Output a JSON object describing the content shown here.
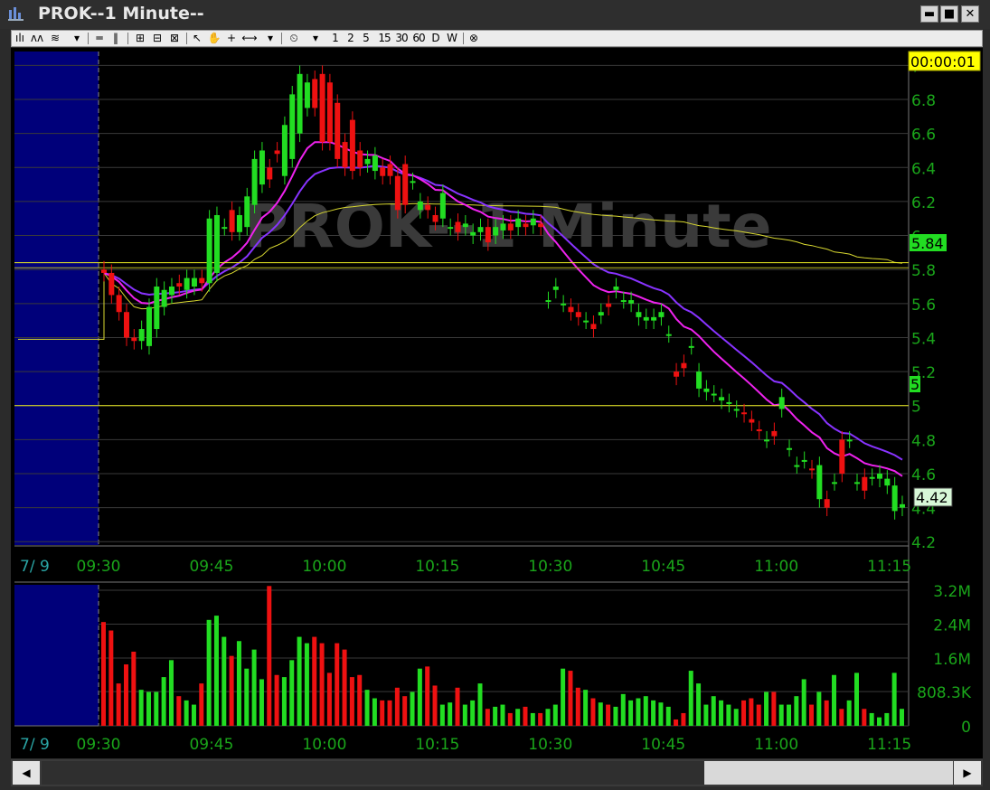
{
  "window": {
    "title": "PROK--1 Minute--",
    "minimize": "▬",
    "maximize": "■",
    "close": "✕"
  },
  "toolbar": {
    "intervals": [
      "1",
      "2",
      "5",
      "15",
      "30",
      "60",
      "D",
      "W"
    ]
  },
  "clock": "00:00:01",
  "watermark": "PROK--1 Minute",
  "colors": {
    "up": "#22dd22",
    "down": "#ee1111",
    "ema_fast": "#ee22ee",
    "ema_slow": "#8833ff",
    "vwap": "#d8d830",
    "level": "#eeee22",
    "premarket": "#00007a",
    "grid": "#3a3a3a",
    "axis_text": "#1aa51a"
  },
  "price_labels": {
    "level_high": "5.84",
    "level_line": "5",
    "last": "4.42"
  },
  "x_axis": {
    "date": "7/ 9",
    "ticks": [
      "09:30",
      "09:45",
      "10:00",
      "10:15",
      "10:30",
      "10:45",
      "11:00",
      "11:15"
    ]
  },
  "chart_data": [
    {
      "type": "candlestick",
      "title": "PROK--1 Minute",
      "y_ticks": [
        "4.2",
        "4.4",
        "4.6",
        "4.8",
        "5",
        "5.2",
        "5.4",
        "5.6",
        "5.8",
        "6",
        "6.2",
        "6.4",
        "6.6",
        "6.8",
        "7"
      ],
      "ylim": [
        4.18,
        7.05
      ],
      "x": [
        "09:30",
        "09:31",
        "09:32",
        "09:33",
        "09:34",
        "09:35",
        "09:36",
        "09:37",
        "09:38",
        "09:39",
        "09:40",
        "09:41",
        "09:42",
        "09:43",
        "09:44",
        "09:45",
        "09:46",
        "09:47",
        "09:48",
        "09:49",
        "09:50",
        "09:51",
        "09:52",
        "09:53",
        "09:54",
        "09:55",
        "09:56",
        "09:57",
        "09:58",
        "09:59",
        "10:00",
        "10:01",
        "10:02",
        "10:03",
        "10:04",
        "10:05",
        "10:06",
        "10:07",
        "10:08",
        "10:09",
        "10:10",
        "10:11",
        "10:12",
        "10:13",
        "10:14",
        "10:15",
        "10:16",
        "10:17",
        "10:18",
        "10:19",
        "10:20",
        "10:21",
        "10:22",
        "10:23",
        "10:24",
        "10:25",
        "10:26",
        "10:27",
        "10:28",
        "10:29",
        "10:30",
        "10:31",
        "10:32",
        "10:33",
        "10:34",
        "10:35",
        "10:36",
        "10:37",
        "10:38",
        "10:39",
        "10:40",
        "10:41",
        "10:42",
        "10:43",
        "10:44",
        "10:45",
        "10:46",
        "10:47",
        "10:48",
        "10:49",
        "10:50",
        "10:51",
        "10:52",
        "10:53",
        "10:54",
        "10:55",
        "10:56",
        "10:57",
        "10:58",
        "10:59",
        "11:00",
        "11:01",
        "11:02",
        "11:03",
        "11:04",
        "11:05",
        "11:06",
        "11:07",
        "11:08",
        "11:09",
        "11:10",
        "11:11",
        "11:12",
        "11:13",
        "11:14",
        "11:15",
        "11:16"
      ],
      "open": [
        5.8,
        5.78,
        5.65,
        5.55,
        5.4,
        5.38,
        5.35,
        5.45,
        5.58,
        5.65,
        5.72,
        5.68,
        5.7,
        5.75,
        5.72,
        5.78,
        6.05,
        6.15,
        6.02,
        6.05,
        6.18,
        6.3,
        6.4,
        6.5,
        6.35,
        6.45,
        6.6,
        6.75,
        6.92,
        6.95,
        6.9,
        6.78,
        6.55,
        6.68,
        6.5,
        6.42,
        6.38,
        6.4,
        6.42,
        6.35,
        6.42,
        6.32,
        6.15,
        6.18,
        6.12,
        6.1,
        6.05,
        6.08,
        6.05,
        6.0,
        6.02,
        6.05,
        6.0,
        6.03,
        6.07,
        6.05,
        6.07,
        6.06,
        6.07,
        5.62,
        5.68,
        5.6,
        5.58,
        5.55,
        5.5,
        5.48,
        5.53,
        5.6,
        5.68,
        5.62,
        5.6,
        5.52,
        5.5,
        5.5,
        5.52,
        5.42,
        5.2,
        5.25,
        5.35,
        5.1,
        5.08,
        5.07,
        5.03,
        5.01,
        4.98,
        4.96,
        4.92,
        4.86,
        4.8,
        4.85,
        4.98,
        4.75,
        4.65,
        4.68,
        4.63,
        4.45,
        4.45,
        4.55,
        4.8,
        4.8,
        4.55,
        4.58,
        4.58,
        4.57,
        4.53,
        4.38,
        4.4
      ],
      "close": [
        5.78,
        5.65,
        5.55,
        5.4,
        5.38,
        5.45,
        5.58,
        5.7,
        5.68,
        5.7,
        5.7,
        5.75,
        5.75,
        5.72,
        6.1,
        6.12,
        6.05,
        6.02,
        6.12,
        6.23,
        6.45,
        6.5,
        6.33,
        6.48,
        6.65,
        6.83,
        6.95,
        6.9,
        6.75,
        6.55,
        6.55,
        6.45,
        6.4,
        6.38,
        6.4,
        6.45,
        6.47,
        6.35,
        6.35,
        6.15,
        6.18,
        6.32,
        6.2,
        6.15,
        6.08,
        6.25,
        6.05,
        6.02,
        6.07,
        6.02,
        6.05,
        5.96,
        6.05,
        6.07,
        6.03,
        6.1,
        6.05,
        6.1,
        6.05,
        5.62,
        5.7,
        5.6,
        5.55,
        5.52,
        5.5,
        5.45,
        5.55,
        5.58,
        5.7,
        5.62,
        5.62,
        5.55,
        5.52,
        5.52,
        5.55,
        5.42,
        5.17,
        5.22,
        5.35,
        5.2,
        5.1,
        5.07,
        5.05,
        5.02,
        4.98,
        4.95,
        4.9,
        4.85,
        4.8,
        4.82,
        5.05,
        4.75,
        4.65,
        4.68,
        4.62,
        4.65,
        4.4,
        4.55,
        4.6,
        4.8,
        4.55,
        4.5,
        4.58,
        4.6,
        4.57,
        4.53,
        4.42
      ]
    },
    {
      "type": "bar",
      "title": "Volume",
      "y_ticks": [
        "0",
        "808.3K",
        "1.6M",
        "2.4M",
        "3.2M"
      ],
      "ylim": [
        0,
        3200000
      ],
      "values": [
        2450000,
        2250000,
        1000000,
        1450000,
        1750000,
        850000,
        800000,
        800000,
        1150000,
        1550000,
        700000,
        600000,
        500000,
        1000000,
        2500000,
        2600000,
        2100000,
        1650000,
        2000000,
        1350000,
        1800000,
        1100000,
        3300000,
        1200000,
        1150000,
        1550000,
        2100000,
        1950000,
        2100000,
        1950000,
        1250000,
        1950000,
        1800000,
        1150000,
        1200000,
        850000,
        650000,
        600000,
        600000,
        900000,
        700000,
        800000,
        1350000,
        1400000,
        950000,
        500000,
        550000,
        900000,
        500000,
        600000,
        1000000,
        400000,
        450000,
        500000,
        300000,
        400000,
        450000,
        300000,
        300000,
        400000,
        500000,
        1350000,
        1300000,
        900000,
        850000,
        650000,
        550000,
        500000,
        450000,
        750000,
        600000,
        650000,
        700000,
        600000,
        550000,
        450000,
        150000,
        300000,
        1300000,
        1000000,
        500000,
        700000,
        600000,
        500000,
        400000,
        600000,
        650000,
        500000,
        800000,
        800000,
        500000,
        500000,
        700000,
        1100000,
        500000,
        800000,
        600000,
        1200000,
        400000,
        600000,
        1250000,
        400000,
        300000,
        200000,
        300000,
        1250000,
        400000
      ]
    }
  ]
}
